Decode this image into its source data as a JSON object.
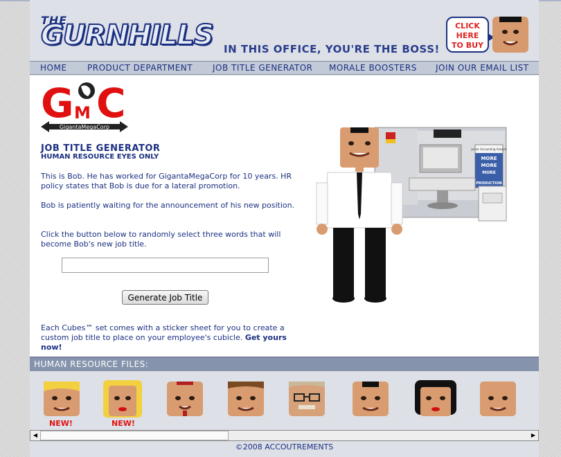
{
  "header": {
    "logo_the": "THE",
    "logo_main": "GURNHILLS",
    "tagline": "IN THIS OFFICE, YOU'RE THE BOSS!",
    "buy_lines": [
      "CLICK",
      "HERE",
      "TO BUY"
    ]
  },
  "nav": {
    "items": [
      {
        "label": "HOME"
      },
      {
        "label": "PRODUCT DEPARTMENT"
      },
      {
        "label": "JOB TITLE GENERATOR"
      },
      {
        "label": "MORALE BOOSTERS"
      },
      {
        "label": "JOIN OUR EMAIL LIST"
      }
    ]
  },
  "gmc": {
    "letters": "GMC",
    "name": "GigantaMegaCorp"
  },
  "main": {
    "title": "JOB TITLE GENERATOR",
    "subtitle": "HUMAN RESOURCE EYES ONLY",
    "para1": "This is Bob. He has worked for GigantaMegaCorp for 10 years. HR policy states that Bob is due for a lateral promotion.",
    "para2": "Bob is patiently waiting for the announcement of his new position.",
    "para3": "Click the button below to randomly select three words that will become Bob's new job title.",
    "result_value": "",
    "button_label": "Generate Job Title",
    "promo_text": "Each Cubes™ set comes with a sticker sheet for you to create a custom job title to place on your employee's cubicle. ",
    "promo_link": "Get yours now!"
  },
  "product_labels": {
    "sign_top": "Junior Accounting Analyst",
    "poster_lines": [
      "MORE",
      "MORE",
      "MORE",
      "PRODUCTION"
    ]
  },
  "hr_files": {
    "title": "HUMAN RESOURCE FILES:",
    "new_label": "NEW!",
    "faces": [
      {
        "hair": "blonde-short",
        "new": true
      },
      {
        "hair": "blonde-long",
        "new": true
      },
      {
        "hair": "bald-goatee",
        "new": false
      },
      {
        "hair": "brown",
        "new": false
      },
      {
        "hair": "glasses-mustache",
        "new": false
      },
      {
        "hair": "black-short",
        "new": false
      },
      {
        "hair": "black-long",
        "new": false
      },
      {
        "hair": "bald",
        "new": false
      }
    ]
  },
  "footer": {
    "text": "©2008 ACCOUTREMENTS"
  },
  "colors": {
    "brand_blue": "#1a2f80",
    "accent_red": "#e01010",
    "nav_bg": "#c3cad7",
    "hr_bar_bg": "#8593ad"
  }
}
